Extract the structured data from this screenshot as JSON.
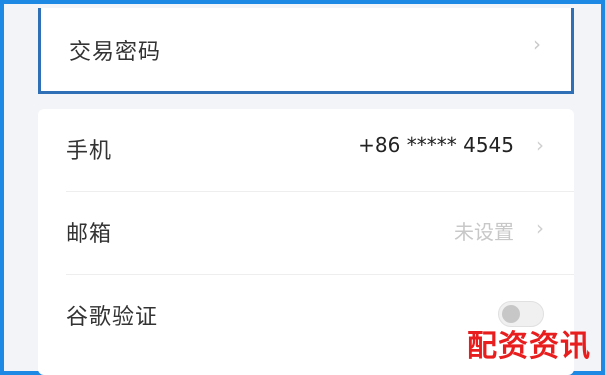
{
  "top_item": {
    "label": "交易密码",
    "chevron": "›"
  },
  "settings": {
    "phone": {
      "label": "手机",
      "value": "+86 ***** 4545",
      "chevron": "›"
    },
    "email": {
      "label": "邮箱",
      "value": "未设置",
      "chevron": "›"
    },
    "google_auth": {
      "label": "谷歌验证",
      "enabled": false
    }
  },
  "watermark": {
    "text": "配资资讯"
  }
}
